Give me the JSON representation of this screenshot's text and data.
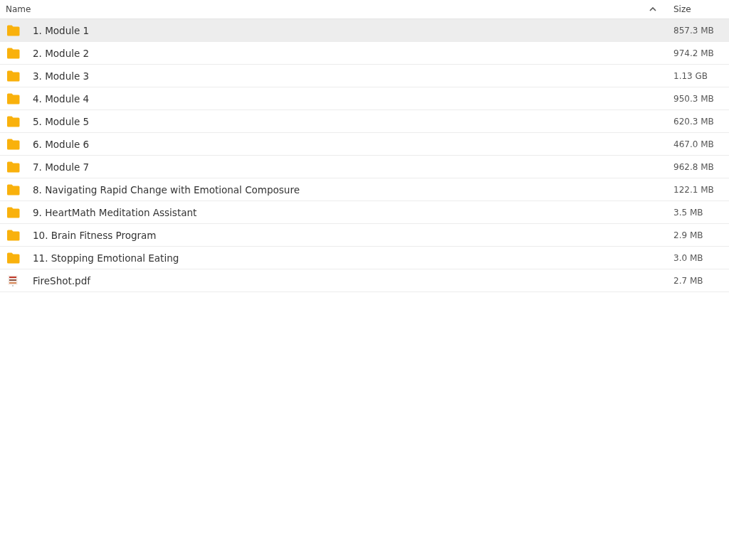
{
  "table": {
    "columns": [
      {
        "label": "Name",
        "sorted": true
      },
      {
        "label": "Size",
        "sorted": false
      }
    ],
    "rows": [
      {
        "name": "1. Module 1",
        "size": "857.3 MB",
        "kind": "folder",
        "selected": true
      },
      {
        "name": "2. Module 2",
        "size": "974.2 MB",
        "kind": "folder",
        "selected": false
      },
      {
        "name": "3. Module 3",
        "size": "1.13 GB",
        "kind": "folder",
        "selected": false
      },
      {
        "name": "4. Module 4",
        "size": "950.3 MB",
        "kind": "folder",
        "selected": false
      },
      {
        "name": "5. Module 5",
        "size": "620.3 MB",
        "kind": "folder",
        "selected": false
      },
      {
        "name": "6. Module 6",
        "size": "467.0 MB",
        "kind": "folder",
        "selected": false
      },
      {
        "name": "7. Module 7",
        "size": "962.8 MB",
        "kind": "folder",
        "selected": false
      },
      {
        "name": "8. Navigating Rapid Change with Emotional Composure",
        "size": "122.1 MB",
        "kind": "folder",
        "selected": false
      },
      {
        "name": "9. HeartMath Meditation Assistant",
        "size": "3.5 MB",
        "kind": "folder",
        "selected": false
      },
      {
        "name": "10. Brain Fitness Program",
        "size": "2.9 MB",
        "kind": "folder",
        "selected": false
      },
      {
        "name": "11. Stopping Emotional Eating",
        "size": "3.0 MB",
        "kind": "folder",
        "selected": false
      },
      {
        "name": "FireShot.pdf",
        "size": "2.7 MB",
        "kind": "pdf",
        "selected": false
      }
    ]
  }
}
